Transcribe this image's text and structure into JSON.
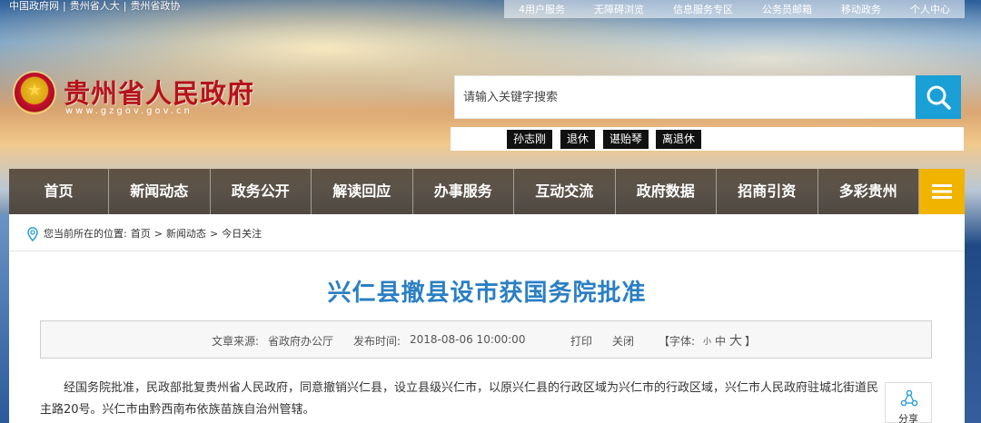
{
  "top_links": {
    "left": [
      "中国政府网",
      "贵州省人大",
      "贵州省政协"
    ],
    "right": [
      "4用户服务",
      "无障碍浏览",
      "信息服务专区",
      "公务员邮箱",
      "移动政务",
      "个人中心"
    ]
  },
  "brand": {
    "title": "贵州省人民政府",
    "domain": "www.gzgov.gov.cn",
    "color": "#b5121b"
  },
  "search": {
    "placeholder": "请输入关键字搜索",
    "button_color": "#1a9fd6",
    "hot_tags": [
      "孙志刚",
      "退休",
      "谌贻琴",
      "离退休"
    ]
  },
  "nav": {
    "items": [
      "首页",
      "新闻动态",
      "政务公开",
      "解读回应",
      "办事服务",
      "互动交流",
      "政府数据",
      "招商引资",
      "多彩贵州"
    ],
    "more_color": "#f0b400"
  },
  "breadcrumb": {
    "prefix": "您当前所在的位置:",
    "items": [
      "首页",
      "新闻动态",
      "今日关注"
    ]
  },
  "article": {
    "title": "兴仁县撤县设市获国务院批准",
    "source_label": "文章来源:",
    "source": "省政府办公厅",
    "time_label": "发布时间:",
    "time": "2018-08-06 10:00:00",
    "print": "打印",
    "close": "关闭",
    "font_label": "【字体:",
    "font_small": "小",
    "font_mid": "中",
    "font_big": "大",
    "font_end": "】",
    "body": "经国务院批准，民政部批复贵州省人民政府，同意撤销兴仁县，设立县级兴仁市，以原兴仁县的行政区域为兴仁市的行政区域，兴仁市人民政府驻城北街道民主路20号。兴仁市由黔西南布依族苗族自治州管辖。",
    "title_color": "#2b7fc3"
  },
  "share": {
    "label": "分享"
  }
}
